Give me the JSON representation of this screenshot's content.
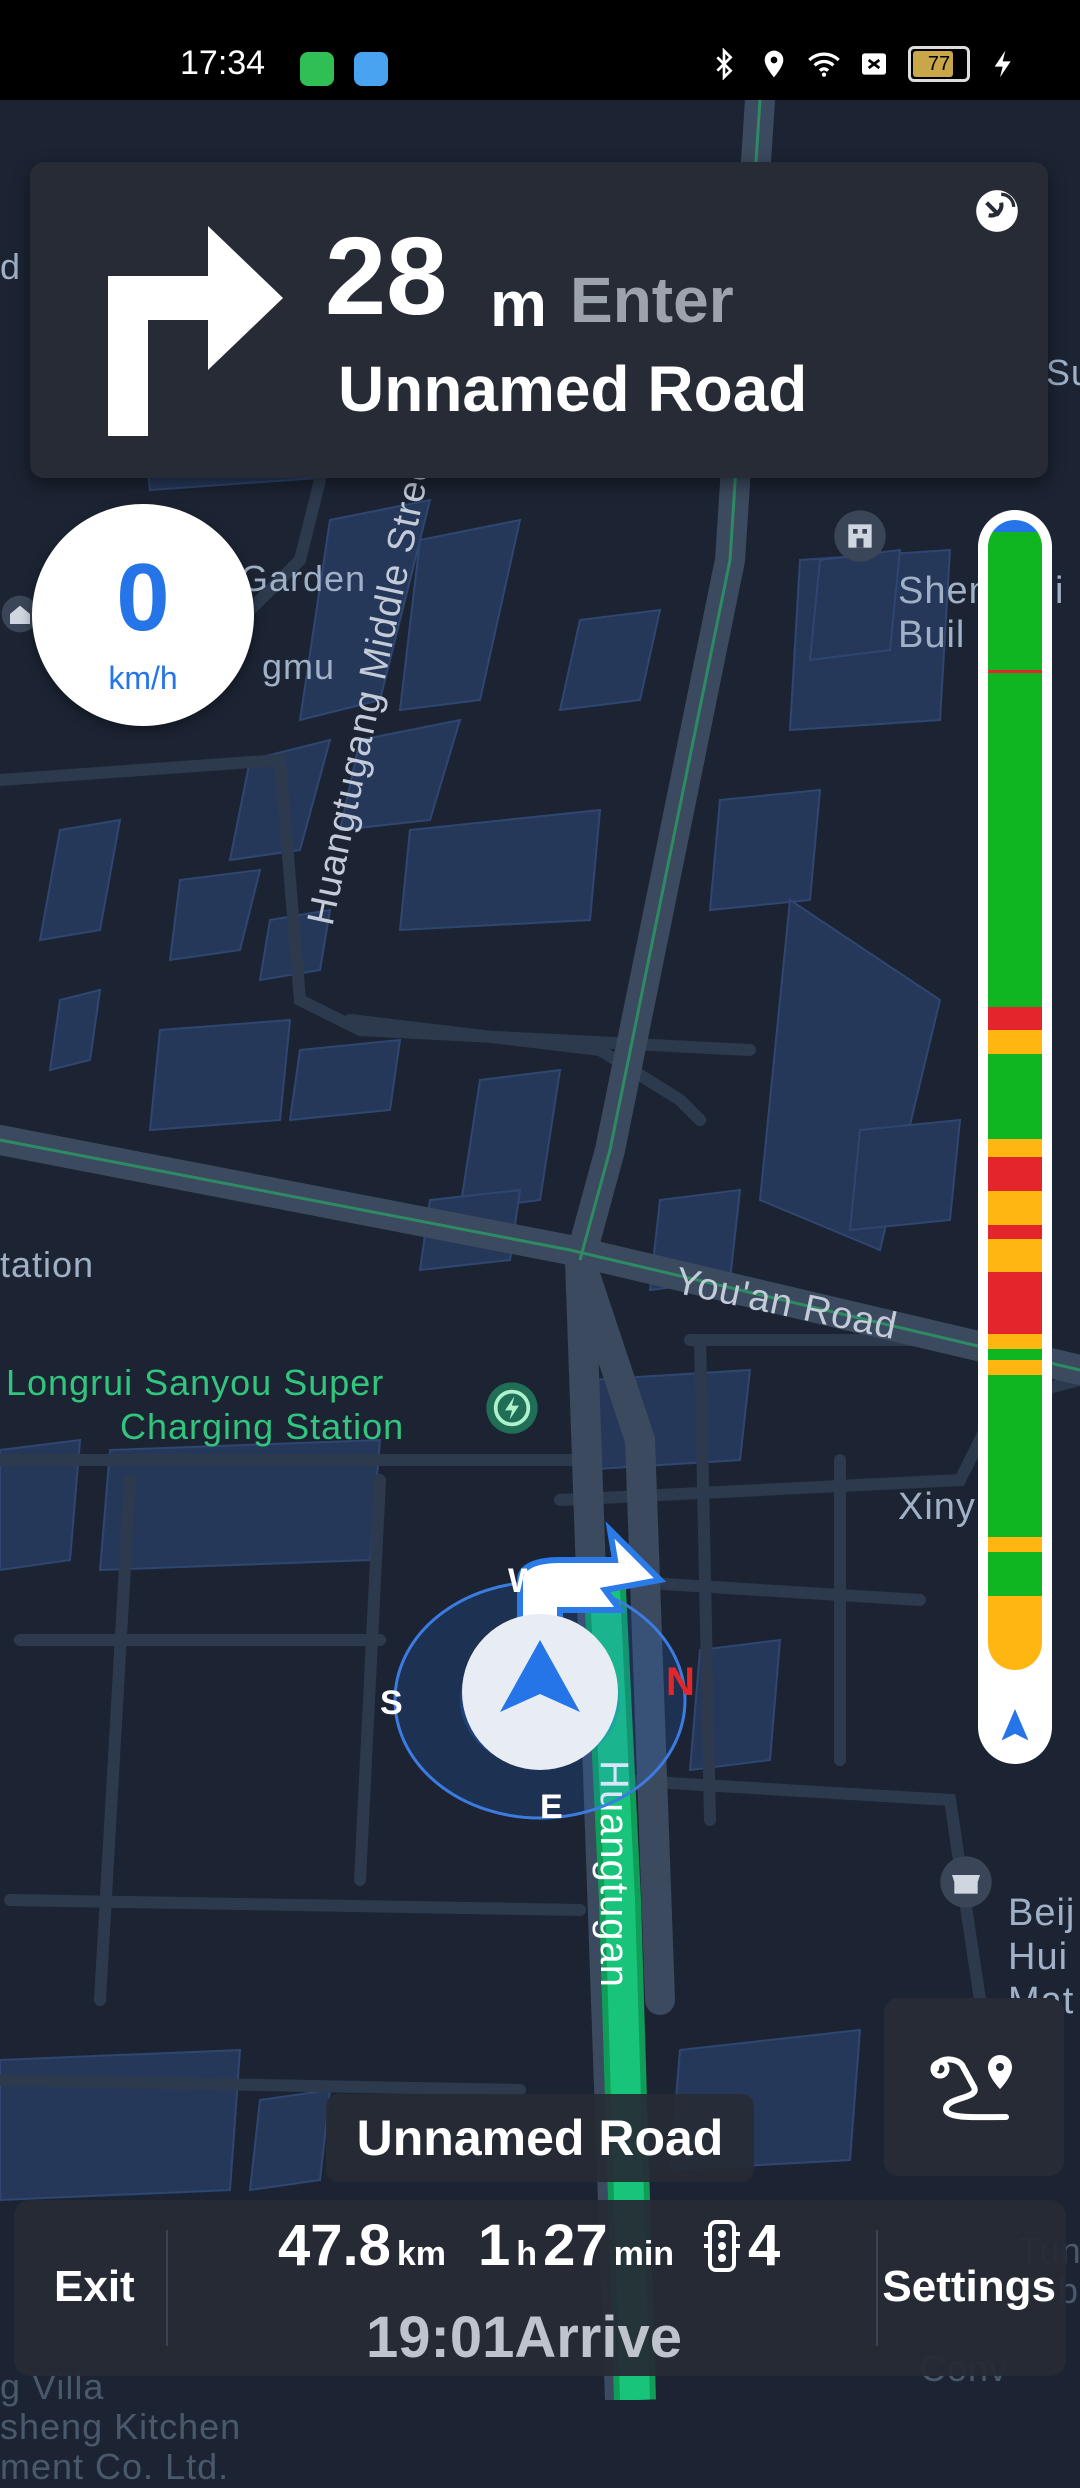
{
  "status_bar": {
    "time": "17:34",
    "icons": [
      "shield-app-icon",
      "weather-app-icon",
      "bluetooth-icon",
      "location-icon",
      "wifi-icon",
      "no-sim-icon",
      "battery-icon",
      "charging-icon"
    ],
    "battery_level": "77"
  },
  "guidance": {
    "distance_value": "28",
    "distance_unit": "m",
    "action": "Enter",
    "road_name": "Unnamed Road"
  },
  "speed": {
    "value": "0",
    "unit": "km/h"
  },
  "map_labels": {
    "garden_1": "Garden",
    "garden_2": "t",
    "garden_3": "gmu",
    "station_left": "tation",
    "charging_1": "Longrui Sanyou Super",
    "charging_2": "Charging Station",
    "huangtugang_middle": "Huangtugang Middle Street",
    "youan_road": "You'an Road",
    "huangtugan_lower": "Huangtugan",
    "sheng_1": "Shengchi",
    "sheng_2": "Buil",
    "xiny": "Xiny",
    "beij_1": "Beij",
    "beij_2": "Hui",
    "beij_3": "Mat",
    "top_left_frag": "d Li",
    "top_right_frag": "Su",
    "bottom_left_1": "g Villa",
    "bottom_left_2": "sheng Kitchen",
    "bottom_left_3": "ment Co. Ltd.",
    "bottom_right_1": "Tuna",
    "bottom_right_2": "Toba",
    "bottom_right_3": "Conv"
  },
  "compass": {
    "north": "N",
    "south": "S",
    "east": "E",
    "west": "W"
  },
  "traffic_colors": {
    "green": "#10b622",
    "red": "#e3262b",
    "yellow": "#ffb611",
    "blue": "#2574e8"
  },
  "current_road": "Unnamed Road",
  "bottom_bar": {
    "exit_label": "Exit",
    "settings_label": "Settings",
    "distance_value": "47.8",
    "distance_unit": "km",
    "time_hours": "1",
    "time_h_unit": "h",
    "time_minutes": "27",
    "time_min_unit": "min",
    "traffic_lights": "4",
    "arrive_time": "19:01",
    "arrive_label": "Arrive"
  }
}
